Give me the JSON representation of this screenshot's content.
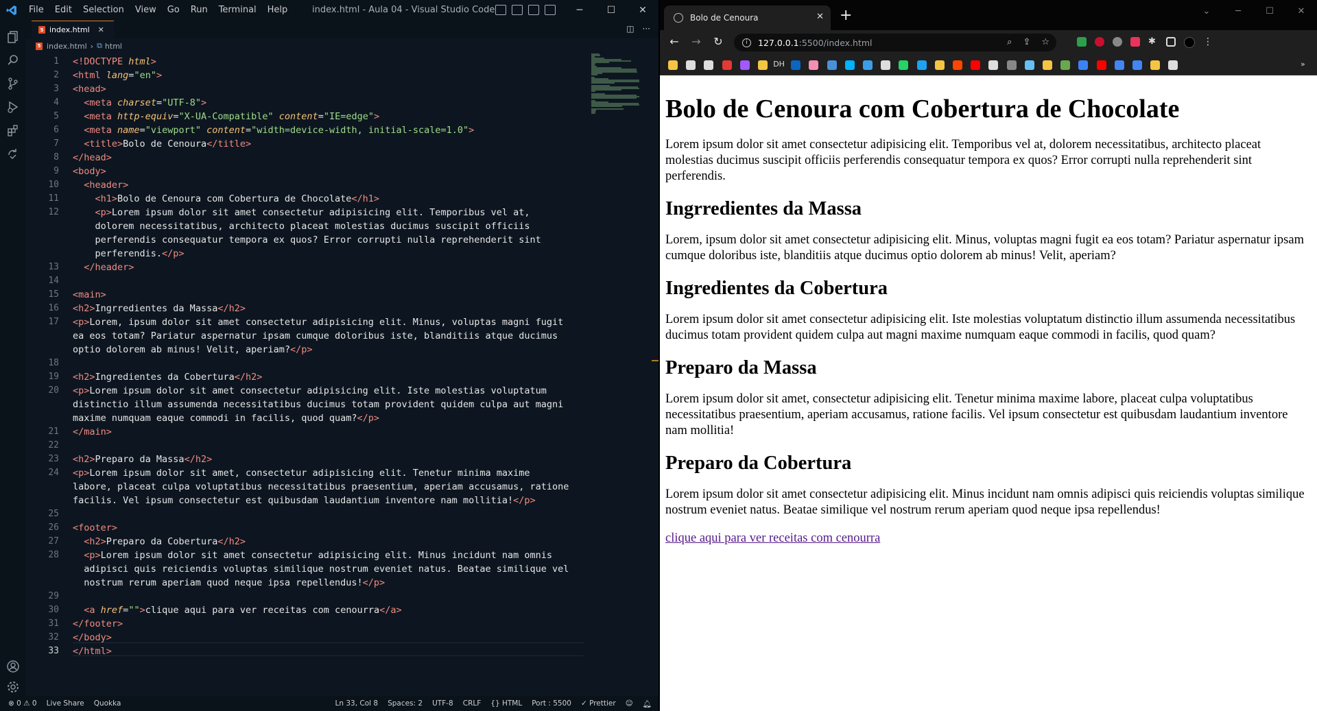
{
  "vscode": {
    "menu": [
      "File",
      "Edit",
      "Selection",
      "View",
      "Go",
      "Run",
      "Terminal",
      "Help"
    ],
    "window_title": "index.html - Aula 04 - Visual Studio Code",
    "tab_label": "index.html",
    "breadcrumb": [
      "index.html",
      "html"
    ],
    "status_left": [
      "⊗ 0 ⚠ 0",
      "Live Share",
      "Quokka"
    ],
    "status_right": [
      "Ln 33, Col 8",
      "Spaces: 2",
      "UTF-8",
      "CRLF",
      "{} HTML",
      "Port : 5500",
      "✓ Prettier"
    ],
    "code": [
      {
        "n": "1",
        "segs": [
          [
            "t-doc",
            "<!DOCTYPE "
          ],
          [
            "t-attr",
            "html"
          ],
          [
            "t-doc",
            ">"
          ]
        ]
      },
      {
        "n": "2",
        "segs": [
          [
            "t-tag",
            "<html "
          ],
          [
            "t-attr",
            "lang"
          ],
          [
            "t-txt",
            "="
          ],
          [
            "t-str",
            "\"en\""
          ],
          [
            "t-tag",
            ">"
          ]
        ]
      },
      {
        "n": "3",
        "segs": [
          [
            "t-tag",
            "<head>"
          ]
        ]
      },
      {
        "n": "4",
        "segs": [
          [
            "t-txt",
            "  "
          ],
          [
            "t-tag",
            "<meta "
          ],
          [
            "t-attr",
            "charset"
          ],
          [
            "t-txt",
            "="
          ],
          [
            "t-str",
            "\"UTF-8\""
          ],
          [
            "t-tag",
            ">"
          ]
        ]
      },
      {
        "n": "5",
        "segs": [
          [
            "t-txt",
            "  "
          ],
          [
            "t-tag",
            "<meta "
          ],
          [
            "t-attr",
            "http-equiv"
          ],
          [
            "t-txt",
            "="
          ],
          [
            "t-str",
            "\"X-UA-Compatible\" "
          ],
          [
            "t-attr",
            "content"
          ],
          [
            "t-txt",
            "="
          ],
          [
            "t-str",
            "\"IE=edge\""
          ],
          [
            "t-tag",
            ">"
          ]
        ]
      },
      {
        "n": "6",
        "segs": [
          [
            "t-txt",
            "  "
          ],
          [
            "t-tag",
            "<meta "
          ],
          [
            "t-attr",
            "name"
          ],
          [
            "t-txt",
            "="
          ],
          [
            "t-str",
            "\"viewport\" "
          ],
          [
            "t-attr",
            "content"
          ],
          [
            "t-txt",
            "="
          ],
          [
            "t-str",
            "\"width=device-width, initial-scale=1.0\""
          ],
          [
            "t-tag",
            ">"
          ]
        ]
      },
      {
        "n": "7",
        "segs": [
          [
            "t-txt",
            "  "
          ],
          [
            "t-tag",
            "<title>"
          ],
          [
            "t-txt",
            "Bolo de Cenoura"
          ],
          [
            "t-tag",
            "</title>"
          ]
        ]
      },
      {
        "n": "8",
        "segs": [
          [
            "t-tag",
            "</head>"
          ]
        ]
      },
      {
        "n": "9",
        "segs": [
          [
            "t-tag",
            "<body>"
          ]
        ]
      },
      {
        "n": "10",
        "segs": [
          [
            "t-txt",
            "  "
          ],
          [
            "t-tag",
            "<header>"
          ]
        ]
      },
      {
        "n": "11",
        "segs": [
          [
            "t-txt",
            "    "
          ],
          [
            "t-tag",
            "<h1>"
          ],
          [
            "t-txt",
            "Bolo de Cenoura com Cobertura de Chocolate"
          ],
          [
            "t-tag",
            "</h1>"
          ]
        ]
      },
      {
        "n": "12",
        "segs": [
          [
            "t-txt",
            "    "
          ],
          [
            "t-tag",
            "<p>"
          ],
          [
            "t-txt",
            "Lorem ipsum dolor sit amet consectetur adipisicing elit. Temporibus vel at,"
          ]
        ]
      },
      {
        "n": "",
        "segs": [
          [
            "t-txt",
            "    dolorem necessitatibus, architecto placeat molestias ducimus suscipit officiis"
          ]
        ]
      },
      {
        "n": "",
        "segs": [
          [
            "t-txt",
            "    perferendis consequatur tempora ex quos? Error corrupti nulla reprehenderit sint"
          ]
        ]
      },
      {
        "n": "",
        "segs": [
          [
            "t-txt",
            "    perferendis."
          ],
          [
            "t-tag",
            "</p>"
          ]
        ]
      },
      {
        "n": "13",
        "segs": [
          [
            "t-txt",
            "  "
          ],
          [
            "t-tag",
            "</header>"
          ]
        ]
      },
      {
        "n": "14",
        "segs": []
      },
      {
        "n": "15",
        "segs": [
          [
            "t-tag",
            "<main>"
          ]
        ]
      },
      {
        "n": "16",
        "segs": [
          [
            "t-tag",
            "<h2>"
          ],
          [
            "t-txt",
            "Ingrredientes da Massa"
          ],
          [
            "t-tag",
            "</h2>"
          ]
        ]
      },
      {
        "n": "17",
        "segs": [
          [
            "t-tag",
            "<p>"
          ],
          [
            "t-txt",
            "Lorem, ipsum dolor sit amet consectetur adipisicing elit. Minus, voluptas magni fugit"
          ]
        ]
      },
      {
        "n": "",
        "segs": [
          [
            "t-txt",
            "ea eos totam? Pariatur aspernatur ipsam cumque doloribus iste, blanditiis atque ducimus"
          ]
        ]
      },
      {
        "n": "",
        "segs": [
          [
            "t-txt",
            "optio dolorem ab minus! Velit, aperiam?"
          ],
          [
            "t-tag",
            "</p>"
          ]
        ]
      },
      {
        "n": "18",
        "segs": []
      },
      {
        "n": "19",
        "segs": [
          [
            "t-tag",
            "<h2>"
          ],
          [
            "t-txt",
            "Ingredientes da Cobertura"
          ],
          [
            "t-tag",
            "</h2>"
          ]
        ]
      },
      {
        "n": "20",
        "segs": [
          [
            "t-tag",
            "<p>"
          ],
          [
            "t-txt",
            "Lorem ipsum dolor sit amet consectetur adipisicing elit. Iste molestias voluptatum"
          ]
        ]
      },
      {
        "n": "",
        "segs": [
          [
            "t-txt",
            "distinctio illum assumenda necessitatibus ducimus totam provident quidem culpa aut magni"
          ]
        ]
      },
      {
        "n": "",
        "segs": [
          [
            "t-txt",
            "maxime numquam eaque commodi in facilis, quod quam?"
          ],
          [
            "t-tag",
            "</p>"
          ]
        ]
      },
      {
        "n": "21",
        "segs": [
          [
            "t-tag",
            "</main>"
          ]
        ]
      },
      {
        "n": "22",
        "segs": []
      },
      {
        "n": "23",
        "segs": [
          [
            "t-tag",
            "<h2>"
          ],
          [
            "t-txt",
            "Preparo da Massa"
          ],
          [
            "t-tag",
            "</h2>"
          ]
        ]
      },
      {
        "n": "24",
        "segs": [
          [
            "t-tag",
            "<p>"
          ],
          [
            "t-txt",
            "Lorem ipsum dolor sit amet, consectetur adipisicing elit. Tenetur minima maxime"
          ]
        ]
      },
      {
        "n": "",
        "segs": [
          [
            "t-txt",
            "labore, placeat culpa voluptatibus necessitatibus praesentium, aperiam accusamus, ratione"
          ]
        ]
      },
      {
        "n": "",
        "segs": [
          [
            "t-txt",
            "facilis. Vel ipsum consectetur est quibusdam laudantium inventore nam mollitia!"
          ],
          [
            "t-tag",
            "</p>"
          ]
        ]
      },
      {
        "n": "25",
        "segs": []
      },
      {
        "n": "26",
        "segs": [
          [
            "t-tag",
            "<footer>"
          ]
        ]
      },
      {
        "n": "27",
        "segs": [
          [
            "t-txt",
            "  "
          ],
          [
            "t-tag",
            "<h2>"
          ],
          [
            "t-txt",
            "Preparo da Cobertura"
          ],
          [
            "t-tag",
            "</h2>"
          ]
        ]
      },
      {
        "n": "28",
        "segs": [
          [
            "t-txt",
            "  "
          ],
          [
            "t-tag",
            "<p>"
          ],
          [
            "t-txt",
            "Lorem ipsum dolor sit amet consectetur adipisicing elit. Minus incidunt nam omnis"
          ]
        ]
      },
      {
        "n": "",
        "segs": [
          [
            "t-txt",
            "  adipisci quis reiciendis voluptas similique nostrum eveniet natus. Beatae similique vel"
          ]
        ]
      },
      {
        "n": "",
        "segs": [
          [
            "t-txt",
            "  nostrum rerum aperiam quod neque ipsa repellendus!"
          ],
          [
            "t-tag",
            "</p>"
          ]
        ]
      },
      {
        "n": "29",
        "segs": []
      },
      {
        "n": "30",
        "segs": [
          [
            "t-txt",
            "  "
          ],
          [
            "t-tag",
            "<a "
          ],
          [
            "t-attr",
            "href"
          ],
          [
            "t-txt",
            "="
          ],
          [
            "t-str",
            "\"\""
          ],
          [
            "t-tag",
            ">"
          ],
          [
            "t-txt",
            "clique aqui para ver receitas com cenourra"
          ],
          [
            "t-tag",
            "</a>"
          ]
        ]
      },
      {
        "n": "31",
        "segs": [
          [
            "t-tag",
            "</footer>"
          ]
        ]
      },
      {
        "n": "32",
        "segs": [
          [
            "t-tag",
            "</body>"
          ]
        ]
      },
      {
        "n": "33",
        "segs": [
          [
            "t-tag",
            "</html>"
          ]
        ]
      }
    ]
  },
  "browser": {
    "tab_title": "Bolo de Cenoura",
    "url_host": "127.0.0.1",
    "url_path": ":5500/index.html",
    "bookmark_label": "DH",
    "page": {
      "h1": "Bolo de Cenoura com Cobertura de Chocolate",
      "p1": "Lorem ipsum dolor sit amet consectetur adipisicing elit. Temporibus vel at, dolorem necessitatibus, architecto placeat molestias ducimus suscipit officiis perferendis consequatur tempora ex quos? Error corrupti nulla reprehenderit sint perferendis.",
      "h2_1": "Ingrredientes da Massa",
      "p2": "Lorem, ipsum dolor sit amet consectetur adipisicing elit. Minus, voluptas magni fugit ea eos totam? Pariatur aspernatur ipsam cumque doloribus iste, blanditiis atque ducimus optio dolorem ab minus! Velit, aperiam?",
      "h2_2": "Ingredientes da Cobertura",
      "p3": "Lorem ipsum dolor sit amet consectetur adipisicing elit. Iste molestias voluptatum distinctio illum assumenda necessitatibus ducimus totam provident quidem culpa aut magni maxime numquam eaque commodi in facilis, quod quam?",
      "h2_3": "Preparo da Massa",
      "p4": "Lorem ipsum dolor sit amet, consectetur adipisicing elit. Tenetur minima maxime labore, placeat culpa voluptatibus necessitatibus praesentium, aperiam accusamus, ratione facilis. Vel ipsum consectetur est quibusdam laudantium inventore nam mollitia!",
      "h2_4": "Preparo da Cobertura",
      "p5": "Lorem ipsum dolor sit amet consectetur adipisicing elit. Minus incidunt nam omnis adipisci quis reiciendis voluptas similique nostrum eveniet natus. Beatae similique vel nostrum rerum aperiam quod neque ipsa repellendus!",
      "link": "clique aqui para ver receitas com cenourra"
    }
  },
  "colors": {
    "editor_bg": "#0d1620",
    "tag": "#f28b82",
    "attr": "#f6c177",
    "string": "#9fdc8a",
    "link_visited": "#551a8b"
  }
}
